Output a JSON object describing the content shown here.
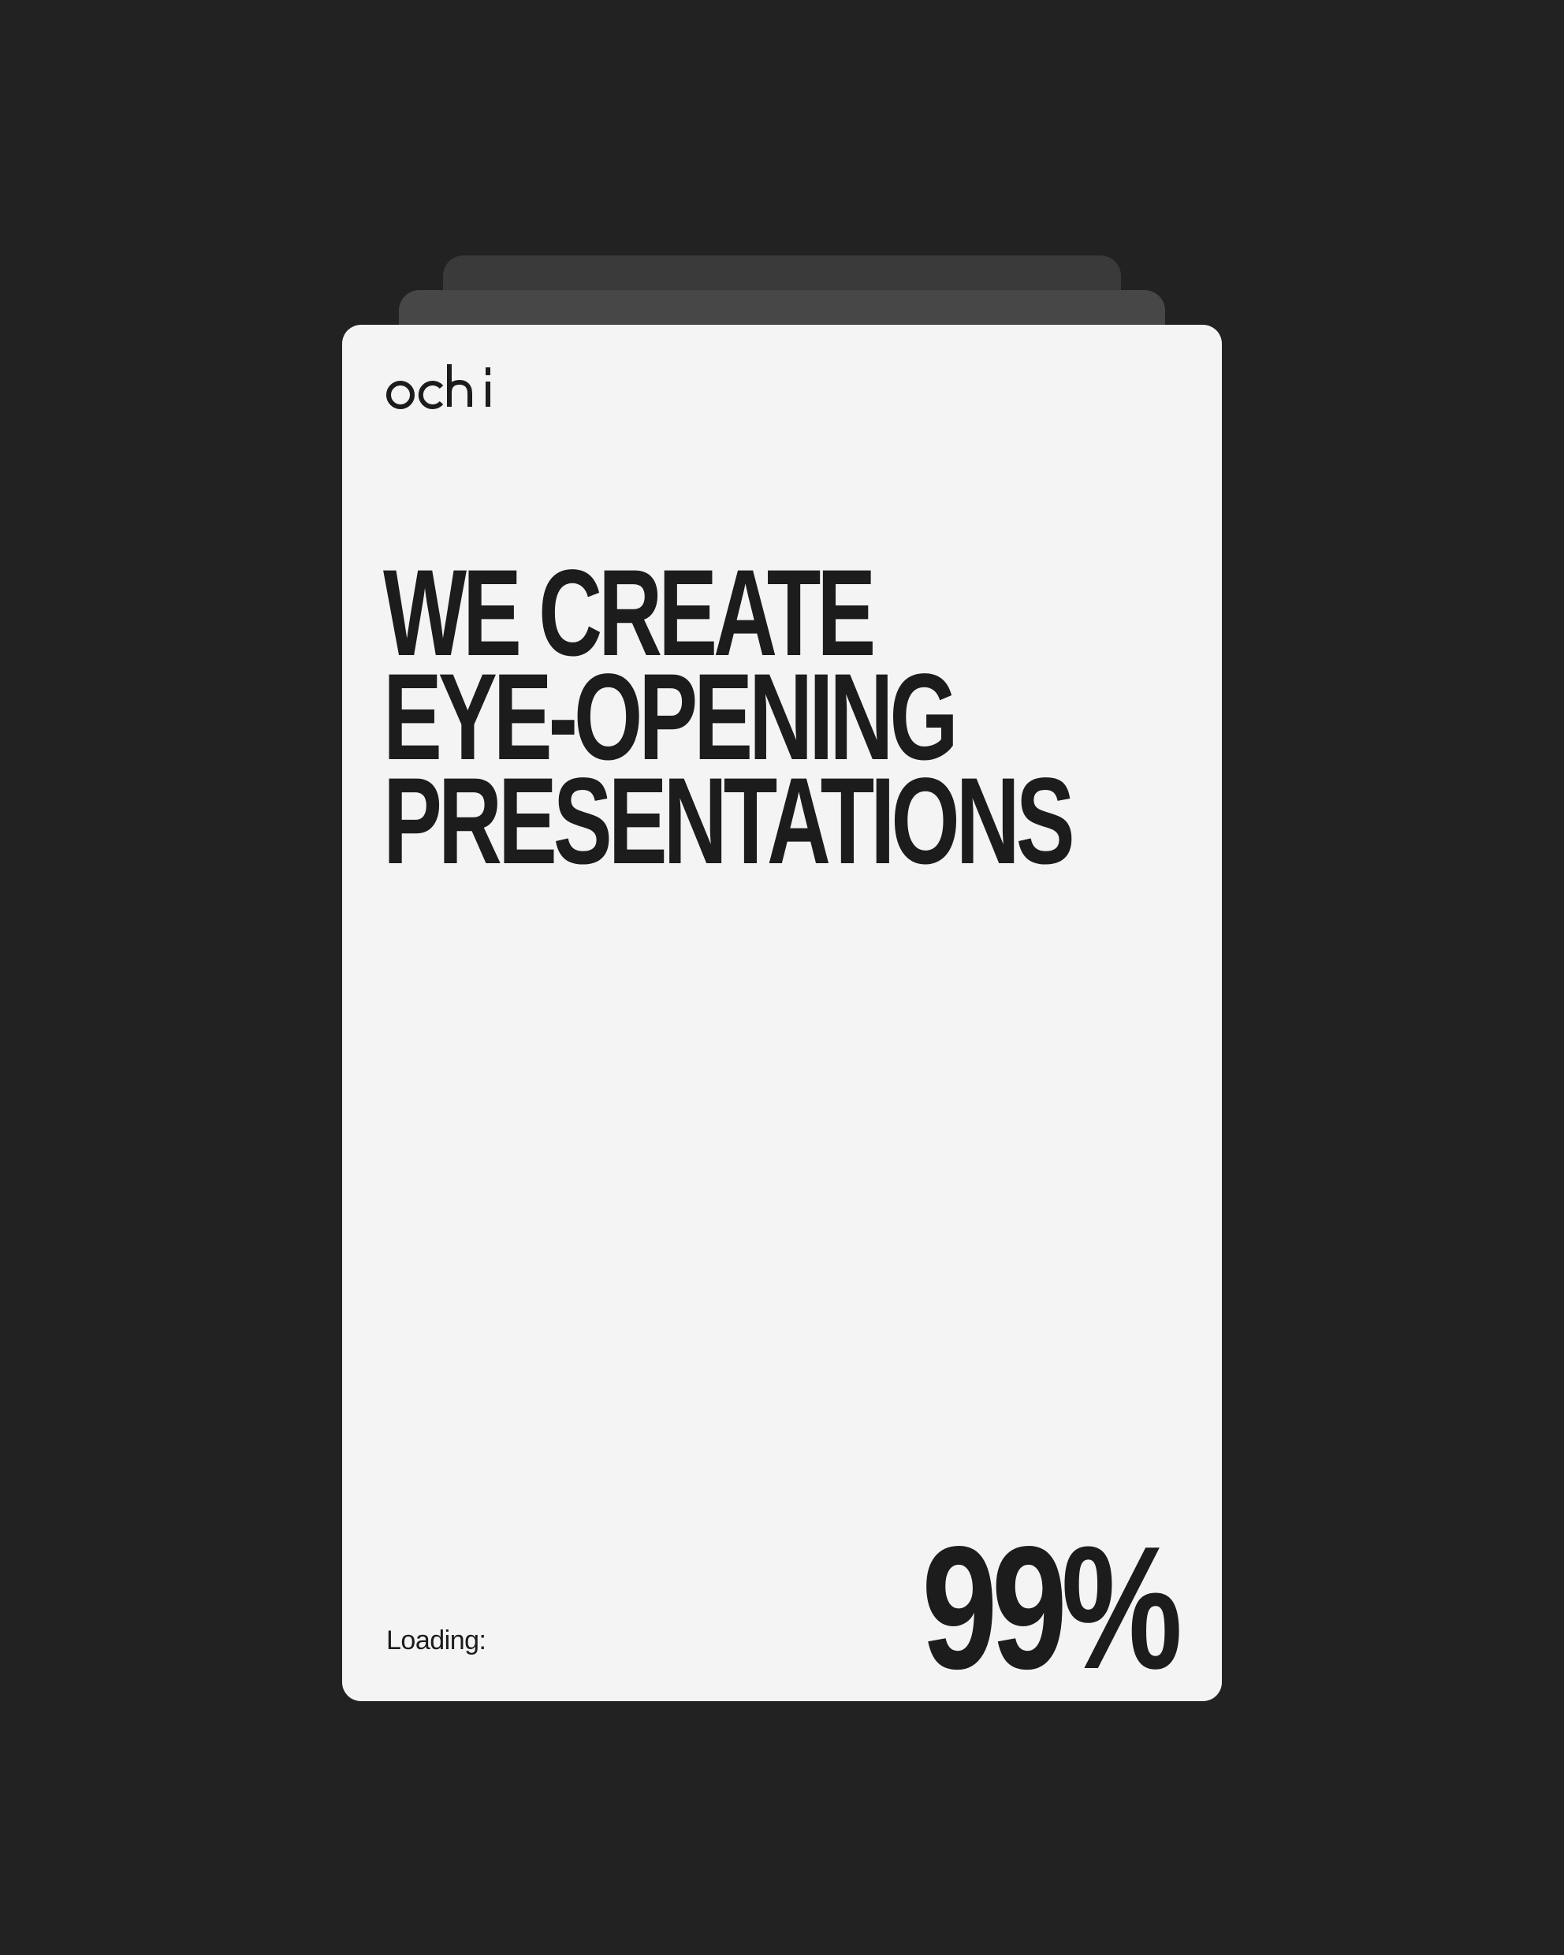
{
  "brand": {
    "logo_text": "ochi"
  },
  "hero": {
    "headline_lines": [
      "WE CREATE",
      "EYE-OPENING",
      "PRESENTATIONS"
    ]
  },
  "loader": {
    "label": "Loading:",
    "progress_text": "99%",
    "progress_fraction": 0.99
  },
  "colors": {
    "background": "#222222",
    "card": "#f4f4f4",
    "text": "#1c1c1c",
    "stack_card_back": "#3a3a3a",
    "stack_card_mid": "#474747"
  }
}
